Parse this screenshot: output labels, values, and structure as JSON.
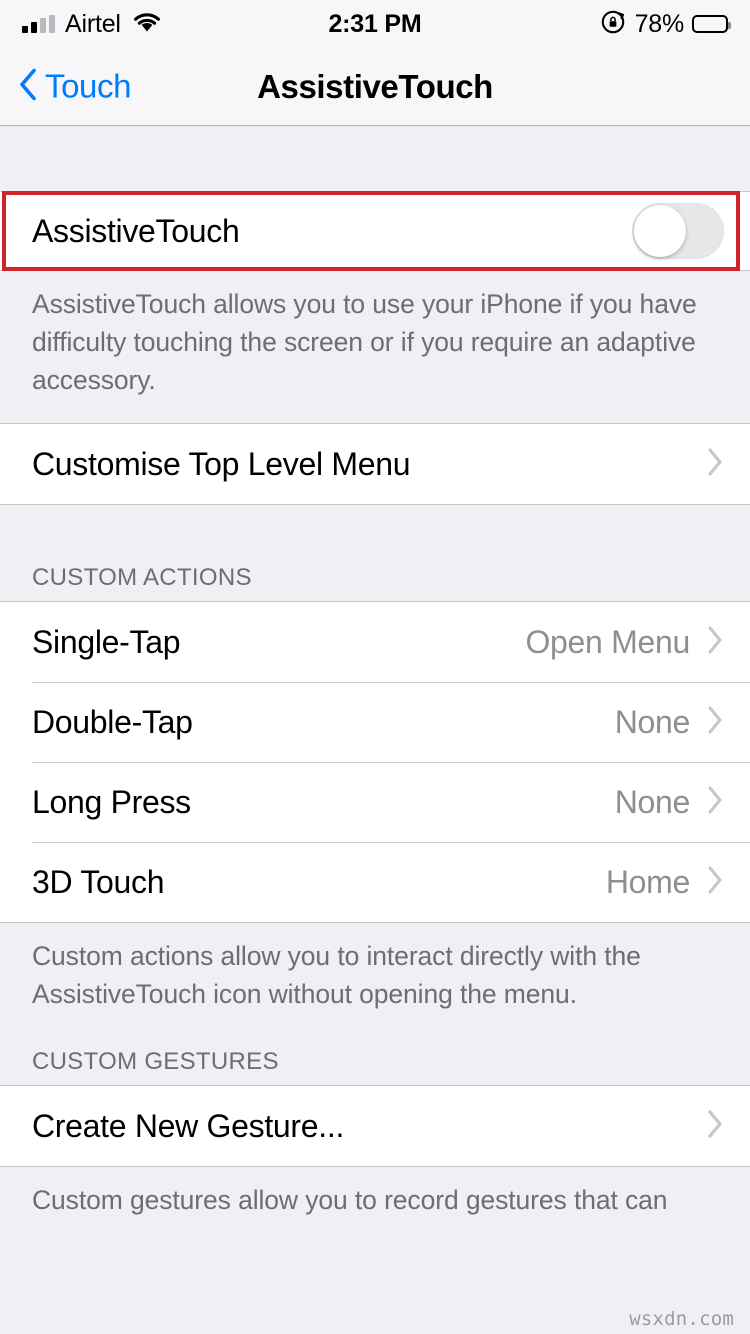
{
  "status_bar": {
    "carrier": "Airtel",
    "time": "2:31 PM",
    "battery_percent": "78%",
    "signal_icon": "signal-bars-icon",
    "wifi_icon": "wifi-icon",
    "rotation_lock_icon": "rotation-lock-icon",
    "battery_icon": "battery-icon"
  },
  "nav_bar": {
    "back_label": "Touch",
    "back_icon": "chevron-left-icon",
    "title": "AssistiveTouch"
  },
  "main": {
    "assistive_touch": {
      "label": "AssistiveTouch",
      "toggle_state": "off",
      "highlighted": true,
      "highlight_color": "#d0232b",
      "footer": "AssistiveTouch allows you to use your iPhone if you have difficulty touching the screen or if you require an adaptive accessory."
    },
    "customise_menu": {
      "label": "Customise Top Level Menu",
      "chevron_icon": "chevron-right-icon"
    },
    "custom_actions": {
      "header": "CUSTOM ACTIONS",
      "rows": [
        {
          "label": "Single-Tap",
          "value": "Open Menu",
          "chevron_icon": "chevron-right-icon"
        },
        {
          "label": "Double-Tap",
          "value": "None",
          "chevron_icon": "chevron-right-icon"
        },
        {
          "label": "Long Press",
          "value": "None",
          "chevron_icon": "chevron-right-icon"
        },
        {
          "label": "3D Touch",
          "value": "Home",
          "chevron_icon": "chevron-right-icon"
        }
      ],
      "footer": "Custom actions allow you to interact directly with the AssistiveTouch icon without opening the menu."
    },
    "custom_gestures": {
      "header": "CUSTOM GESTURES",
      "rows": [
        {
          "label": "Create New Gesture...",
          "chevron_icon": "chevron-right-icon"
        }
      ],
      "footer": "Custom gestures allow you to record gestures that can"
    }
  },
  "watermark": "wsxdn.com",
  "colors": {
    "accent_blue": "#007aff",
    "background": "#efeff4",
    "row_background": "#ffffff",
    "separator": "#c8c7cc",
    "secondary_text": "#8e8e93",
    "header_text": "#6d6d72",
    "highlight_red": "#d0232b"
  }
}
